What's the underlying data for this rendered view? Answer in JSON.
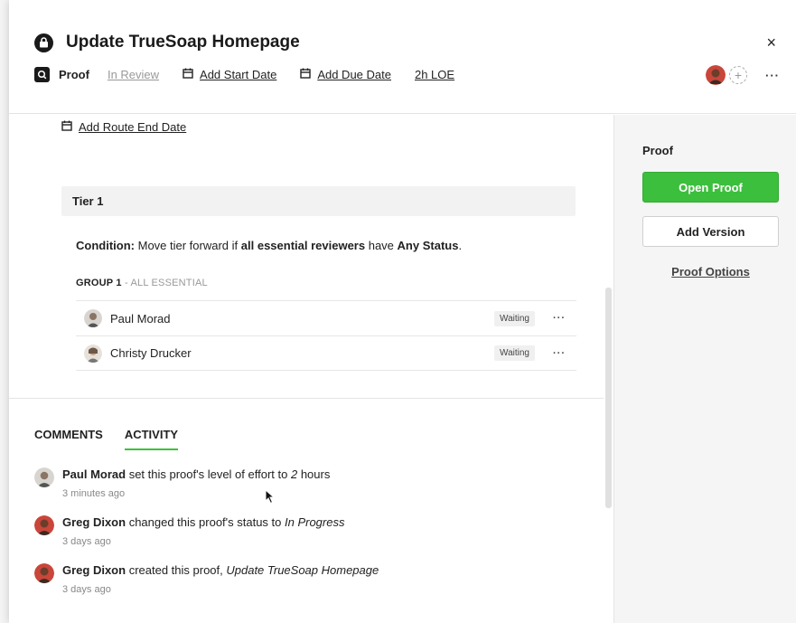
{
  "header": {
    "title": "Update TrueSoap Homepage",
    "type_label": "Proof",
    "status": "In Review",
    "add_start_date": "Add Start Date",
    "add_due_date": "Add Due Date",
    "loe": "2h LOE",
    "close_glyph": "×",
    "more_glyph": "···",
    "add_glyph": "+"
  },
  "route": {
    "add_route_end_date": "Add Route End Date"
  },
  "tier": {
    "name": "Tier 1",
    "condition_label": "Condition:",
    "condition_pre": "Move tier forward if",
    "condition_bold": "all essential reviewers",
    "condition_mid": "have",
    "condition_status": "Any Status",
    "condition_end": ".",
    "group_name": "GROUP 1",
    "group_desc": " - ALL ESSENTIAL",
    "reviewers": [
      {
        "name": "Paul Morad",
        "status": "Waiting",
        "more": "···"
      },
      {
        "name": "Christy Drucker",
        "status": "Waiting",
        "more": "···"
      }
    ]
  },
  "tabs": [
    {
      "label": "COMMENTS",
      "active": false
    },
    {
      "label": "ACTIVITY",
      "active": true
    }
  ],
  "activity": [
    {
      "user": "Paul Morad",
      "text": " set this proof's level of effort to ",
      "emph": "2",
      "text_after": " hours",
      "time": "3 minutes ago"
    },
    {
      "user": "Greg Dixon",
      "text": " changed this proof's status to ",
      "emph": "In Progress",
      "text_after": "",
      "time": "3 days ago"
    },
    {
      "user": "Greg Dixon",
      "text": " created this proof, ",
      "emph": "Update TrueSoap Homepage",
      "text_after": "",
      "time": "3 days ago"
    }
  ],
  "sidebar": {
    "title": "Proof",
    "open_proof": "Open Proof",
    "add_version": "Add Version",
    "proof_options": "Proof Options"
  },
  "colors": {
    "accent_green": "#3cbf3c",
    "tab_underline": "#3bc23b"
  }
}
